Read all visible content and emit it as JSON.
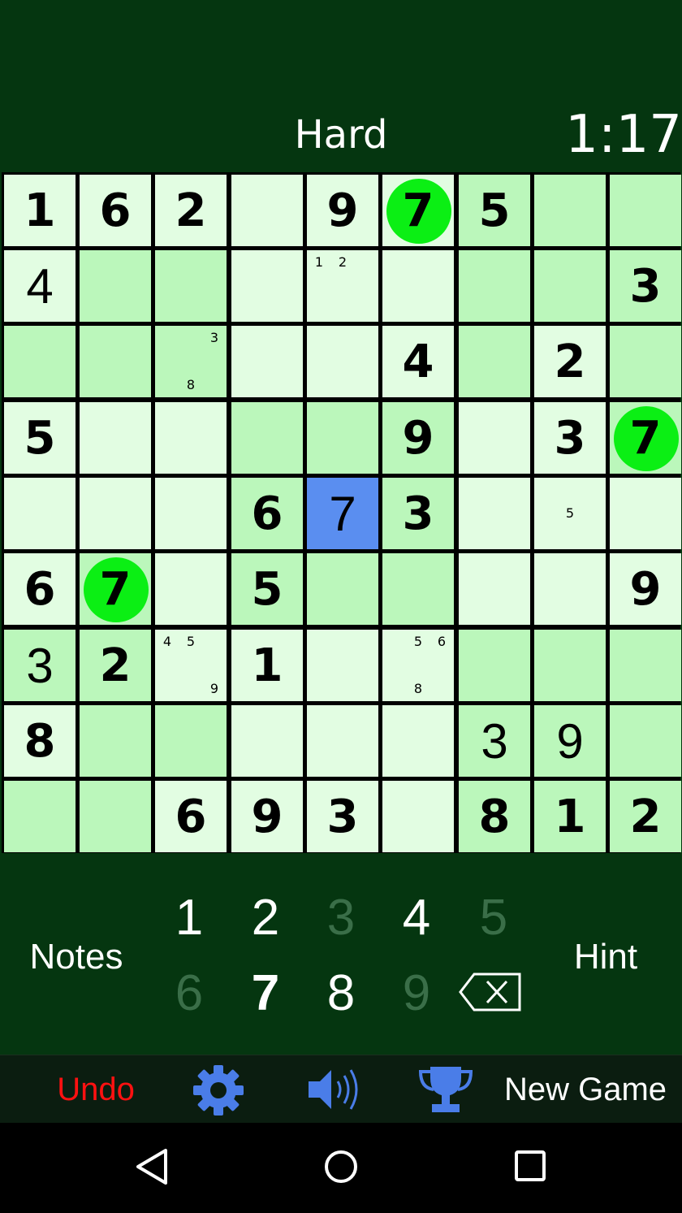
{
  "header": {
    "difficulty": "Hard",
    "timer": "1:17"
  },
  "board": {
    "rows": [
      [
        {
          "v": "1",
          "t": "given"
        },
        {
          "v": "6",
          "t": "given"
        },
        {
          "v": "2",
          "t": "given"
        },
        {},
        {
          "v": "9",
          "t": "given"
        },
        {
          "v": "7",
          "t": "given",
          "h": true
        },
        {
          "v": "5",
          "t": "given"
        },
        {},
        {}
      ],
      [
        {
          "v": "4",
          "t": "user"
        },
        {},
        {},
        {},
        {
          "n": [
            "1",
            "2",
            "",
            "",
            "",
            "",
            "",
            "",
            ""
          ]
        },
        {},
        {},
        {},
        {
          "v": "3",
          "t": "given"
        }
      ],
      [
        {},
        {},
        {
          "n": [
            "",
            "",
            "3",
            "",
            "",
            "",
            "",
            "8",
            ""
          ]
        },
        {},
        {},
        {
          "v": "4",
          "t": "given"
        },
        {},
        {
          "v": "2",
          "t": "given"
        },
        {}
      ],
      [
        {
          "v": "5",
          "t": "given"
        },
        {},
        {},
        {},
        {},
        {
          "v": "9",
          "t": "given"
        },
        {},
        {
          "v": "3",
          "t": "given"
        },
        {
          "v": "7",
          "t": "given",
          "h": true
        }
      ],
      [
        {},
        {},
        {},
        {
          "v": "6",
          "t": "given"
        },
        {
          "v": "7",
          "t": "user",
          "sel": true
        },
        {
          "v": "3",
          "t": "given"
        },
        {},
        {
          "n": [
            "",
            "",
            "",
            "",
            "5",
            "",
            "",
            "",
            ""
          ]
        },
        {}
      ],
      [
        {
          "v": "6",
          "t": "given"
        },
        {
          "v": "7",
          "t": "given",
          "h": true
        },
        {},
        {
          "v": "5",
          "t": "given"
        },
        {},
        {},
        {},
        {},
        {
          "v": "9",
          "t": "given"
        }
      ],
      [
        {
          "v": "3",
          "t": "user"
        },
        {
          "v": "2",
          "t": "given"
        },
        {
          "n": [
            "4",
            "5",
            "",
            "",
            "",
            "",
            "",
            "",
            "9"
          ]
        },
        {
          "v": "1",
          "t": "given"
        },
        {},
        {
          "n": [
            "",
            "5",
            "6",
            "",
            "",
            "",
            "",
            "8",
            ""
          ]
        },
        {},
        {},
        {}
      ],
      [
        {
          "v": "8",
          "t": "given"
        },
        {},
        {},
        {},
        {},
        {},
        {
          "v": "3",
          "t": "user"
        },
        {
          "v": "9",
          "t": "user"
        },
        {}
      ],
      [
        {},
        {},
        {
          "v": "6",
          "t": "given"
        },
        {
          "v": "9",
          "t": "given"
        },
        {
          "v": "3",
          "t": "given"
        },
        {},
        {
          "v": "8",
          "t": "given"
        },
        {
          "v": "1",
          "t": "given"
        },
        {
          "v": "2",
          "t": "given"
        }
      ]
    ],
    "shading": [
      "LLLLLLDDD",
      "LDDLLLDDD",
      "DDDLLLDLD",
      "LLLDDDLLD",
      "LLLDSDLLL",
      "LDLDDDLLL",
      "DDLLLLDDD",
      "LDDLLLDDD",
      "DDLLLLDDD"
    ],
    "colors": {
      "light": "#e2fde2",
      "dark": "#bbf7bb",
      "selected": "#5a8ef0",
      "highlight": "#0bef14"
    }
  },
  "numpad": {
    "notes_label": "Notes",
    "hint_label": "Hint",
    "digits": [
      {
        "label": "1",
        "state": "normal"
      },
      {
        "label": "2",
        "state": "normal"
      },
      {
        "label": "3",
        "state": "disabled"
      },
      {
        "label": "4",
        "state": "normal"
      },
      {
        "label": "5",
        "state": "disabled"
      },
      {
        "label": "6",
        "state": "disabled"
      },
      {
        "label": "7",
        "state": "bold"
      },
      {
        "label": "8",
        "state": "normal"
      },
      {
        "label": "9",
        "state": "disabled"
      }
    ],
    "backspace_icon": "backspace-icon"
  },
  "toolbar": {
    "undo_label": "Undo",
    "settings_icon": "gear-icon",
    "sound_icon": "speaker-icon",
    "trophy_icon": "trophy-icon",
    "new_game_label": "New Game",
    "undo_color": "#ff1111",
    "icon_color": "#4a7de8"
  },
  "navbar": {
    "icons": [
      "back-triangle-icon",
      "home-circle-icon",
      "recent-square-icon"
    ]
  }
}
